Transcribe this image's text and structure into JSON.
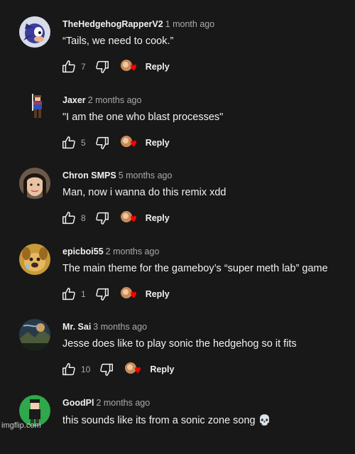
{
  "comments": [
    {
      "author": "TheHedgehogRapperV2",
      "time": "1 month ago",
      "text": "“Tails, we need to cook.”",
      "likes": "7",
      "reply_label": "Reply",
      "avatar": "sonic-avatar"
    },
    {
      "author": "Jaxer",
      "time": "2 months ago",
      "text": "\"I am the one who blast processes\"",
      "likes": "5",
      "reply_label": "Reply",
      "avatar": "pixel-character-avatar"
    },
    {
      "author": "Chron SMPS",
      "time": "5 months ago",
      "text": "Man, now i wanna do this remix xdd",
      "likes": "8",
      "reply_label": "Reply",
      "avatar": "face-avatar"
    },
    {
      "author": "epicboi55",
      "time": "2 months ago",
      "text": "The main theme for the gameboy’s “super meth lab” game",
      "likes": "1",
      "reply_label": "Reply",
      "avatar": "dog-avatar"
    },
    {
      "author": "Mr. Sai",
      "time": "3 months ago",
      "text": "Jesse does like to play sonic the hedgehog so it fits",
      "likes": "10",
      "reply_label": "Reply",
      "avatar": "scenic-avatar"
    },
    {
      "author": "GoodPl",
      "time": "2 months ago",
      "text": "this sounds like its from a sonic zone song 💀",
      "likes": "",
      "reply_label": "",
      "avatar": "green-character-avatar"
    }
  ],
  "watermark": "imgflip.com",
  "colors": {
    "background": "#181818",
    "text": "#f1f1f1",
    "secondary": "#aaaaaa",
    "heart": "#ff0000"
  }
}
